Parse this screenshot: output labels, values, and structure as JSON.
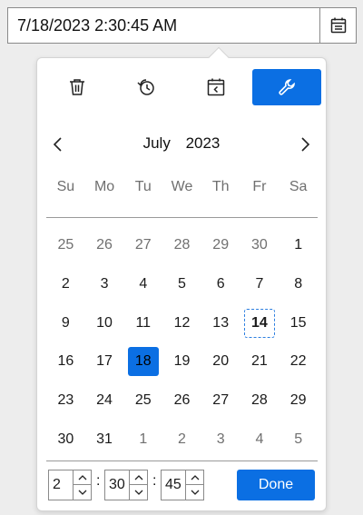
{
  "input": {
    "value": "7/18/2023 2:30:45 AM"
  },
  "toolbar": {
    "buttons": [
      {
        "icon": "trash-icon"
      },
      {
        "icon": "history-icon"
      },
      {
        "icon": "calendar-back-icon"
      },
      {
        "icon": "wrench-icon",
        "active": true
      }
    ]
  },
  "calendar": {
    "month": "July",
    "year": "2023",
    "weekdays": [
      "Su",
      "Mo",
      "Tu",
      "We",
      "Th",
      "Fr",
      "Sa"
    ],
    "days": [
      {
        "label": "25",
        "muted": true
      },
      {
        "label": "26",
        "muted": true
      },
      {
        "label": "27",
        "muted": true
      },
      {
        "label": "28",
        "muted": true
      },
      {
        "label": "29",
        "muted": true
      },
      {
        "label": "30",
        "muted": true
      },
      {
        "label": "1"
      },
      {
        "label": "2"
      },
      {
        "label": "3"
      },
      {
        "label": "4"
      },
      {
        "label": "5"
      },
      {
        "label": "6"
      },
      {
        "label": "7"
      },
      {
        "label": "8"
      },
      {
        "label": "9"
      },
      {
        "label": "10"
      },
      {
        "label": "11"
      },
      {
        "label": "12"
      },
      {
        "label": "13"
      },
      {
        "label": "14",
        "today": true
      },
      {
        "label": "15"
      },
      {
        "label": "16"
      },
      {
        "label": "17"
      },
      {
        "label": "18",
        "selected": true
      },
      {
        "label": "19"
      },
      {
        "label": "20"
      },
      {
        "label": "21"
      },
      {
        "label": "22"
      },
      {
        "label": "23"
      },
      {
        "label": "24"
      },
      {
        "label": "25"
      },
      {
        "label": "26"
      },
      {
        "label": "27"
      },
      {
        "label": "28"
      },
      {
        "label": "29"
      },
      {
        "label": "30"
      },
      {
        "label": "31"
      },
      {
        "label": "1",
        "muted": true
      },
      {
        "label": "2",
        "muted": true
      },
      {
        "label": "3",
        "muted": true
      },
      {
        "label": "4",
        "muted": true
      },
      {
        "label": "5",
        "muted": true
      }
    ]
  },
  "time": {
    "hour": "2",
    "minute": "30",
    "second": "45",
    "separator": ":"
  },
  "done_label": "Done",
  "colors": {
    "accent": "#0b6fe3",
    "today_border": "#2d7fe0"
  }
}
